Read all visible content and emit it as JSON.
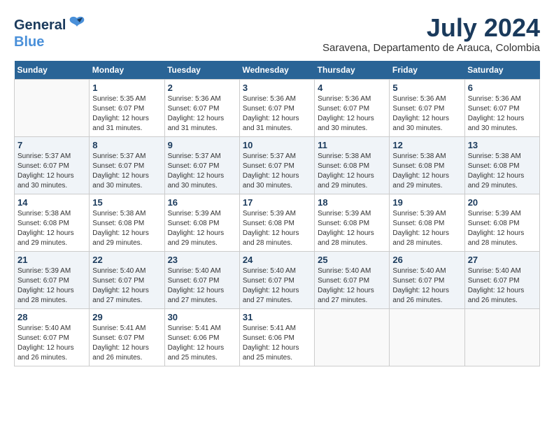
{
  "header": {
    "logo_line1": "General",
    "logo_line2": "Blue",
    "month_year": "July 2024",
    "location": "Saravena, Departamento de Arauca, Colombia"
  },
  "weekdays": [
    "Sunday",
    "Monday",
    "Tuesday",
    "Wednesday",
    "Thursday",
    "Friday",
    "Saturday"
  ],
  "weeks": [
    [
      {
        "day": "",
        "sunrise": "",
        "sunset": "",
        "daylight": ""
      },
      {
        "day": "1",
        "sunrise": "Sunrise: 5:35 AM",
        "sunset": "Sunset: 6:07 PM",
        "daylight": "Daylight: 12 hours and 31 minutes."
      },
      {
        "day": "2",
        "sunrise": "Sunrise: 5:36 AM",
        "sunset": "Sunset: 6:07 PM",
        "daylight": "Daylight: 12 hours and 31 minutes."
      },
      {
        "day": "3",
        "sunrise": "Sunrise: 5:36 AM",
        "sunset": "Sunset: 6:07 PM",
        "daylight": "Daylight: 12 hours and 31 minutes."
      },
      {
        "day": "4",
        "sunrise": "Sunrise: 5:36 AM",
        "sunset": "Sunset: 6:07 PM",
        "daylight": "Daylight: 12 hours and 30 minutes."
      },
      {
        "day": "5",
        "sunrise": "Sunrise: 5:36 AM",
        "sunset": "Sunset: 6:07 PM",
        "daylight": "Daylight: 12 hours and 30 minutes."
      },
      {
        "day": "6",
        "sunrise": "Sunrise: 5:36 AM",
        "sunset": "Sunset: 6:07 PM",
        "daylight": "Daylight: 12 hours and 30 minutes."
      }
    ],
    [
      {
        "day": "7",
        "sunrise": "Sunrise: 5:37 AM",
        "sunset": "Sunset: 6:07 PM",
        "daylight": "Daylight: 12 hours and 30 minutes."
      },
      {
        "day": "8",
        "sunrise": "Sunrise: 5:37 AM",
        "sunset": "Sunset: 6:07 PM",
        "daylight": "Daylight: 12 hours and 30 minutes."
      },
      {
        "day": "9",
        "sunrise": "Sunrise: 5:37 AM",
        "sunset": "Sunset: 6:07 PM",
        "daylight": "Daylight: 12 hours and 30 minutes."
      },
      {
        "day": "10",
        "sunrise": "Sunrise: 5:37 AM",
        "sunset": "Sunset: 6:07 PM",
        "daylight": "Daylight: 12 hours and 30 minutes."
      },
      {
        "day": "11",
        "sunrise": "Sunrise: 5:38 AM",
        "sunset": "Sunset: 6:08 PM",
        "daylight": "Daylight: 12 hours and 29 minutes."
      },
      {
        "day": "12",
        "sunrise": "Sunrise: 5:38 AM",
        "sunset": "Sunset: 6:08 PM",
        "daylight": "Daylight: 12 hours and 29 minutes."
      },
      {
        "day": "13",
        "sunrise": "Sunrise: 5:38 AM",
        "sunset": "Sunset: 6:08 PM",
        "daylight": "Daylight: 12 hours and 29 minutes."
      }
    ],
    [
      {
        "day": "14",
        "sunrise": "Sunrise: 5:38 AM",
        "sunset": "Sunset: 6:08 PM",
        "daylight": "Daylight: 12 hours and 29 minutes."
      },
      {
        "day": "15",
        "sunrise": "Sunrise: 5:38 AM",
        "sunset": "Sunset: 6:08 PM",
        "daylight": "Daylight: 12 hours and 29 minutes."
      },
      {
        "day": "16",
        "sunrise": "Sunrise: 5:39 AM",
        "sunset": "Sunset: 6:08 PM",
        "daylight": "Daylight: 12 hours and 29 minutes."
      },
      {
        "day": "17",
        "sunrise": "Sunrise: 5:39 AM",
        "sunset": "Sunset: 6:08 PM",
        "daylight": "Daylight: 12 hours and 28 minutes."
      },
      {
        "day": "18",
        "sunrise": "Sunrise: 5:39 AM",
        "sunset": "Sunset: 6:08 PM",
        "daylight": "Daylight: 12 hours and 28 minutes."
      },
      {
        "day": "19",
        "sunrise": "Sunrise: 5:39 AM",
        "sunset": "Sunset: 6:08 PM",
        "daylight": "Daylight: 12 hours and 28 minutes."
      },
      {
        "day": "20",
        "sunrise": "Sunrise: 5:39 AM",
        "sunset": "Sunset: 6:08 PM",
        "daylight": "Daylight: 12 hours and 28 minutes."
      }
    ],
    [
      {
        "day": "21",
        "sunrise": "Sunrise: 5:39 AM",
        "sunset": "Sunset: 6:07 PM",
        "daylight": "Daylight: 12 hours and 28 minutes."
      },
      {
        "day": "22",
        "sunrise": "Sunrise: 5:40 AM",
        "sunset": "Sunset: 6:07 PM",
        "daylight": "Daylight: 12 hours and 27 minutes."
      },
      {
        "day": "23",
        "sunrise": "Sunrise: 5:40 AM",
        "sunset": "Sunset: 6:07 PM",
        "daylight": "Daylight: 12 hours and 27 minutes."
      },
      {
        "day": "24",
        "sunrise": "Sunrise: 5:40 AM",
        "sunset": "Sunset: 6:07 PM",
        "daylight": "Daylight: 12 hours and 27 minutes."
      },
      {
        "day": "25",
        "sunrise": "Sunrise: 5:40 AM",
        "sunset": "Sunset: 6:07 PM",
        "daylight": "Daylight: 12 hours and 27 minutes."
      },
      {
        "day": "26",
        "sunrise": "Sunrise: 5:40 AM",
        "sunset": "Sunset: 6:07 PM",
        "daylight": "Daylight: 12 hours and 26 minutes."
      },
      {
        "day": "27",
        "sunrise": "Sunrise: 5:40 AM",
        "sunset": "Sunset: 6:07 PM",
        "daylight": "Daylight: 12 hours and 26 minutes."
      }
    ],
    [
      {
        "day": "28",
        "sunrise": "Sunrise: 5:40 AM",
        "sunset": "Sunset: 6:07 PM",
        "daylight": "Daylight: 12 hours and 26 minutes."
      },
      {
        "day": "29",
        "sunrise": "Sunrise: 5:41 AM",
        "sunset": "Sunset: 6:07 PM",
        "daylight": "Daylight: 12 hours and 26 minutes."
      },
      {
        "day": "30",
        "sunrise": "Sunrise: 5:41 AM",
        "sunset": "Sunset: 6:06 PM",
        "daylight": "Daylight: 12 hours and 25 minutes."
      },
      {
        "day": "31",
        "sunrise": "Sunrise: 5:41 AM",
        "sunset": "Sunset: 6:06 PM",
        "daylight": "Daylight: 12 hours and 25 minutes."
      },
      {
        "day": "",
        "sunrise": "",
        "sunset": "",
        "daylight": ""
      },
      {
        "day": "",
        "sunrise": "",
        "sunset": "",
        "daylight": ""
      },
      {
        "day": "",
        "sunrise": "",
        "sunset": "",
        "daylight": ""
      }
    ]
  ]
}
